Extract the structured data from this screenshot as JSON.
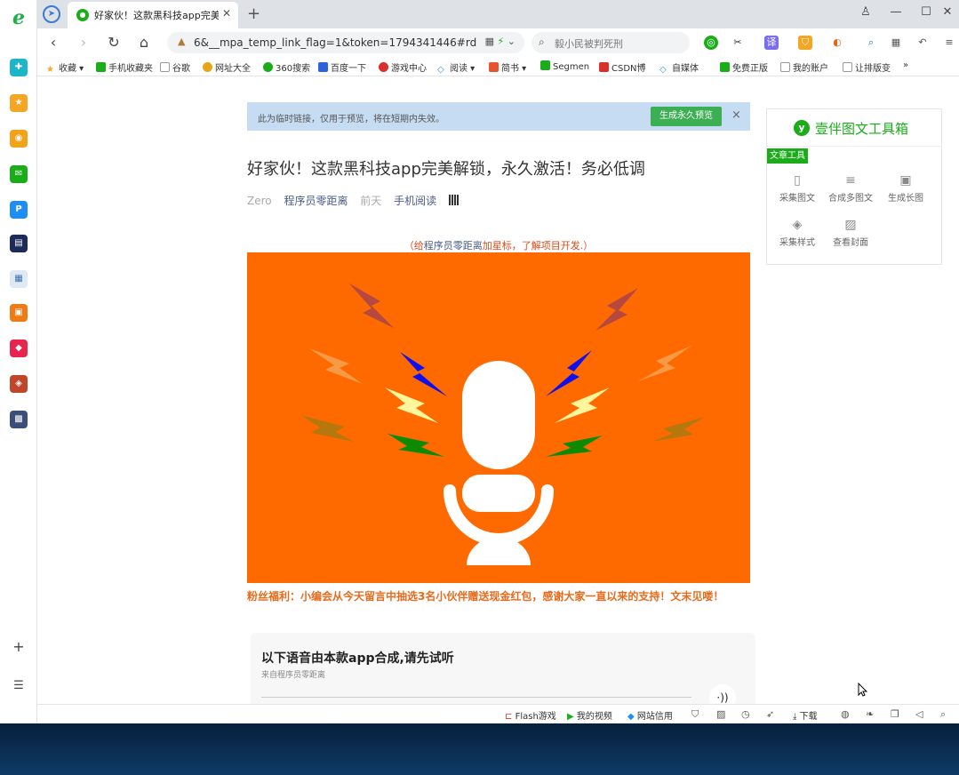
{
  "browser": {
    "tab": {
      "title": "好家伙！这款黑科技app完美解"
    },
    "url": "6&__mpa_temp_link_flag=1&token=1794341446#rd",
    "search_placeholder": "毅小民被判死刑"
  },
  "bookmarks": [
    "收藏",
    "手机收藏夹",
    "谷歌",
    "网址大全",
    "360搜索",
    "百度一下",
    "游戏中心",
    "阅读",
    "简书",
    "Segmen",
    "CSDN博",
    "自媒体",
    "免费正版",
    "我的账户",
    "让排版变",
    "»"
  ],
  "notice": {
    "text": "此为临时链接，仅用于预览，将在短期内失效。",
    "button": "生成永久预览",
    "close": "×"
  },
  "article": {
    "title": "好家伙！这款黑科技app完美解锁，永久激活！务必低调",
    "author": "Zero",
    "account": "程序员零距离",
    "time": "前天",
    "read_on_phone": "手机阅读",
    "follow_prefix": "（给",
    "follow_link": "程序员零距离",
    "follow_suffix": "加星标，了解项目开发.）",
    "fans_benefit": "粉丝福利：小编会从今天留言中抽选3名小伙伴赠送现金红包，感谢大家一直以来的支持！文末见喽！",
    "audio": {
      "title": "以下语音由本款app合成,请先试听",
      "source": "来自程序员零距离",
      "play_icon": "·))"
    }
  },
  "toolbox": {
    "title": "壹伴图文工具箱",
    "section": "文章工具",
    "tools": [
      {
        "label": "采集图文",
        "icon": "document-icon"
      },
      {
        "label": "合成多图文",
        "icon": "list-add-icon"
      },
      {
        "label": "生成长图",
        "icon": "save-icon"
      },
      {
        "label": "采集样式",
        "icon": "layers-icon"
      },
      {
        "label": "查看封面",
        "icon": "image-icon"
      }
    ]
  },
  "statusbar": {
    "flash_games": "Flash游戏",
    "my_video": "我的视频",
    "site_credit": "网站信用",
    "download": "下载"
  },
  "colors": {
    "hero_bg": "#ff6a00",
    "wechat_green": "#1aad19",
    "notice_bg": "#c6dcf2",
    "accent_orange": "#e86a1a"
  }
}
